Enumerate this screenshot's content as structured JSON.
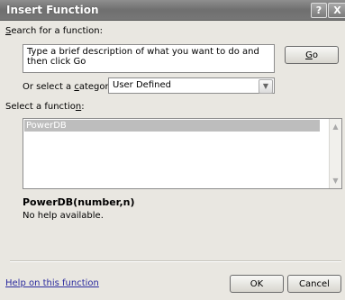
{
  "dialog": {
    "title": "Insert Function",
    "help_glyph": "?",
    "close_glyph": "X"
  },
  "search": {
    "label_accel": "S",
    "label_rest": "earch for a function:",
    "value": "Type a brief description of what you want to do and then click Go",
    "go_accel": "G",
    "go_rest": "o"
  },
  "category": {
    "label_pre": "Or select a ",
    "label_accel": "c",
    "label_rest": "ategory:",
    "selected": "User Defined"
  },
  "functions": {
    "label_pre": "Select a functio",
    "label_accel": "n",
    "label_post": ":",
    "items": [
      "PowerDB"
    ],
    "selected_index": 0
  },
  "details": {
    "signature": "PowerDB(number,n)",
    "description": "No help available."
  },
  "footer": {
    "help_link": "Help on this function",
    "ok_label": "OK",
    "cancel_label": "Cancel"
  },
  "icons": {
    "dropdown": "chevron-down-icon",
    "scroll_up": "scroll-up-icon",
    "scroll_down": "scroll-down-icon"
  }
}
